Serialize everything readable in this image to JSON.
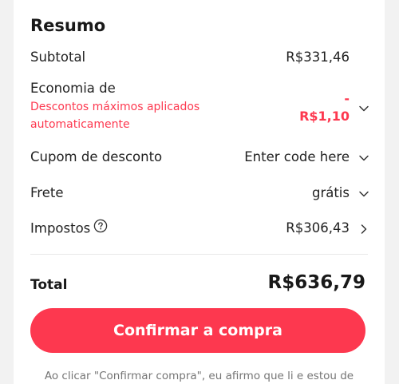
{
  "summary": {
    "title": "Resumo",
    "subtotal": {
      "label": "Subtotal",
      "value": "R$331,46"
    },
    "savings": {
      "label": "Economia de",
      "note": "Descontos máximos aplicados automaticamente",
      "value_sign": "-",
      "value": "R$1,10"
    },
    "coupon": {
      "label": "Cupom de desconto",
      "value": "Enter code here"
    },
    "shipping": {
      "label": "Frete",
      "value": "grátis"
    },
    "taxes": {
      "label": "Impostos",
      "value": "R$306,43"
    },
    "total": {
      "label": "Total",
      "value": "R$636,79"
    }
  },
  "confirm_button": {
    "label": "Confirmar a compra"
  },
  "disclaimer": "Ao clicar \"Confirmar compra\", eu afirmo que li e estou de",
  "colors": {
    "accent": "#fd384f",
    "text": "#222222",
    "muted": "#757575"
  },
  "icons": {
    "savings_toggle": "chevron-down-icon",
    "coupon_toggle": "chevron-down-icon",
    "shipping_toggle": "chevron-down-icon",
    "taxes_help": "question-circle-icon",
    "taxes_toggle": "chevron-right-icon"
  }
}
